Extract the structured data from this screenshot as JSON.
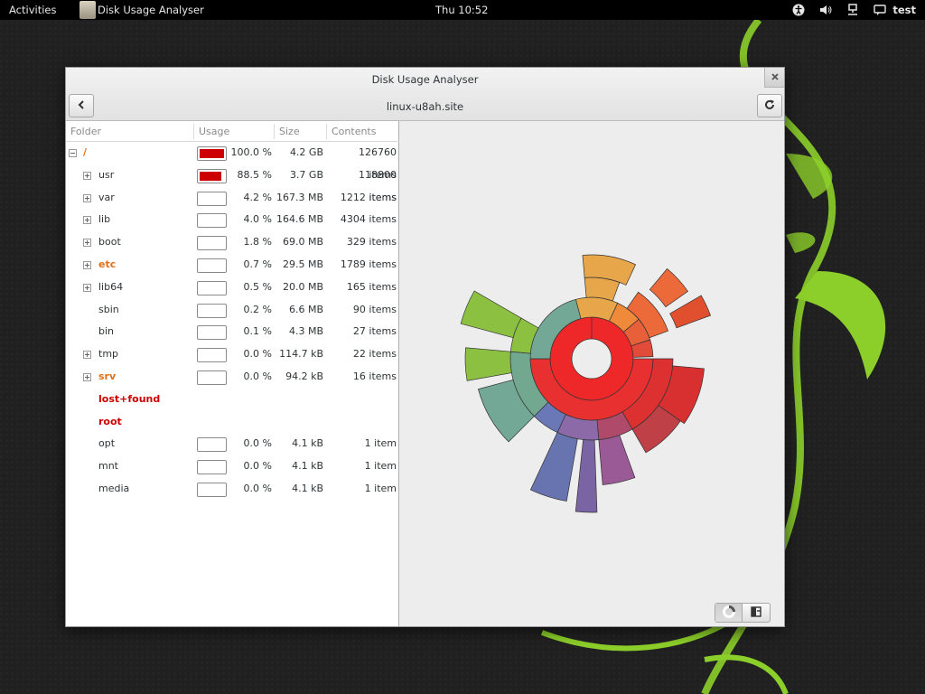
{
  "topbar": {
    "activities": "Activities",
    "app_name": "Disk Usage Analyser",
    "clock": "Thu 10:52",
    "user": "test"
  },
  "window": {
    "title": "Disk Usage Analyser",
    "subtitle": "linux-u8ah.site"
  },
  "columns": {
    "folder": "Folder",
    "usage": "Usage",
    "size": "Size",
    "contents": "Contents"
  },
  "rows": [
    {
      "name": "/",
      "style": "orange",
      "expander": "minus",
      "usage": 1.0,
      "pct": "100.0 %",
      "size": "4.2 GB",
      "items": "126760 items"
    },
    {
      "name": "usr",
      "style": "normal",
      "expander": "plus",
      "usage": 0.885,
      "pct": "88.5 %",
      "size": "3.7 GB",
      "items": "118800 items"
    },
    {
      "name": "var",
      "style": "normal",
      "expander": "plus",
      "usage": 0.042,
      "pct": "4.2 %",
      "size": "167.3 MB",
      "items": "1212 items"
    },
    {
      "name": "lib",
      "style": "normal",
      "expander": "plus",
      "usage": 0.04,
      "pct": "4.0 %",
      "size": "164.6 MB",
      "items": "4304 items"
    },
    {
      "name": "boot",
      "style": "normal",
      "expander": "plus",
      "usage": 0.018,
      "pct": "1.8 %",
      "size": "69.0 MB",
      "items": "329 items"
    },
    {
      "name": "etc",
      "style": "orange",
      "expander": "plus",
      "usage": 0.007,
      "pct": "0.7 %",
      "size": "29.5 MB",
      "items": "1789 items"
    },
    {
      "name": "lib64",
      "style": "normal",
      "expander": "plus",
      "usage": 0.005,
      "pct": "0.5 %",
      "size": "20.0 MB",
      "items": "165 items"
    },
    {
      "name": "sbin",
      "style": "normal",
      "expander": "none",
      "usage": 0.002,
      "pct": "0.2 %",
      "size": "6.6 MB",
      "items": "90 items"
    },
    {
      "name": "bin",
      "style": "normal",
      "expander": "none",
      "usage": 0.001,
      "pct": "0.1 %",
      "size": "4.3 MB",
      "items": "27 items"
    },
    {
      "name": "tmp",
      "style": "normal",
      "expander": "plus",
      "usage": 0.0,
      "pct": "0.0 %",
      "size": "114.7 kB",
      "items": "22 items"
    },
    {
      "name": "srv",
      "style": "orange",
      "expander": "plus",
      "usage": 0.0,
      "pct": "0.0 %",
      "size": "94.2 kB",
      "items": "16 items"
    },
    {
      "name": "lost+found",
      "style": "red",
      "expander": "none",
      "usage": null,
      "pct": "",
      "size": "",
      "items": ""
    },
    {
      "name": "root",
      "style": "red",
      "expander": "none",
      "usage": null,
      "pct": "",
      "size": "",
      "items": ""
    },
    {
      "name": "opt",
      "style": "normal",
      "expander": "none",
      "usage": 0.0,
      "pct": "0.0 %",
      "size": "4.1 kB",
      "items": "1 item"
    },
    {
      "name": "mnt",
      "style": "normal",
      "expander": "none",
      "usage": 0.0,
      "pct": "0.0 %",
      "size": "4.1 kB",
      "items": "1 item"
    },
    {
      "name": "media",
      "style": "normal",
      "expander": "none",
      "usage": 0.0,
      "pct": "0.0 %",
      "size": "4.1 kB",
      "items": "1 item"
    }
  ],
  "icons": {
    "back": "go-back-icon",
    "reload": "reload-icon",
    "close": "close-icon",
    "ring_view": "ring-chart-icon",
    "treemap_view": "treemap-icon",
    "accessibility": "accessibility-icon",
    "volume": "volume-icon",
    "network": "network-icon",
    "user": "user-icon"
  },
  "colors": {
    "usage_fill": "#cc0000",
    "highlight_orange": "#e0701a",
    "highlight_red": "#cc0000"
  },
  "ring_chart": {
    "root_sector": {
      "name": "/",
      "fraction": 1.0
    },
    "sectors": [
      {
        "name": "usr",
        "fraction": 0.885
      },
      {
        "name": "var",
        "fraction": 0.042
      },
      {
        "name": "lib",
        "fraction": 0.04
      },
      {
        "name": "boot",
        "fraction": 0.018
      }
    ]
  }
}
